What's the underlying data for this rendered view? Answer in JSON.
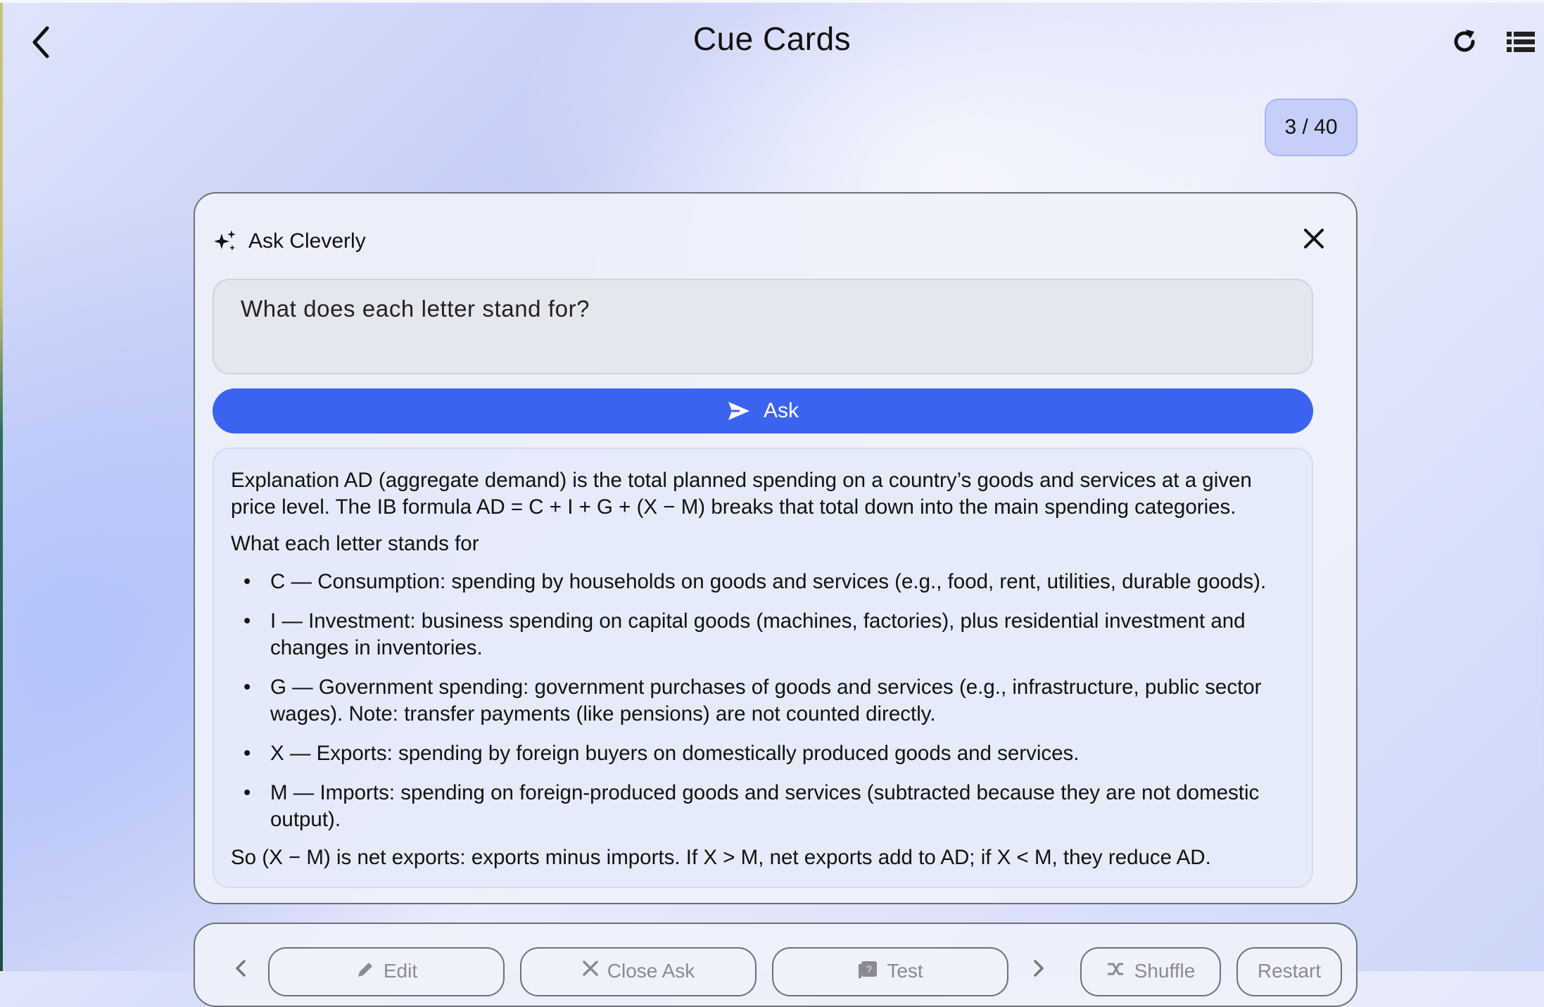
{
  "header": {
    "title": "Cue Cards"
  },
  "counter": {
    "text": "3 / 40"
  },
  "ask_panel": {
    "title": "Ask Cleverly",
    "question": "What does each letter stand for?",
    "ask_label": "Ask",
    "answer": {
      "intro": "Explanation AD (aggregate demand) is the total planned spending on a country’s goods and services at a given price level. The IB formula AD = C + I + G + (X − M) breaks that total down into the main spending categories.",
      "subheading": "What each letter stands for",
      "items": [
        "C — Consumption: spending by households on goods and services (e.g., food, rent, utilities, durable goods).",
        "I — Investment: business spending on capital goods (machines, factories), plus residential investment and changes in inventories.",
        "G — Government spending: government purchases of goods and services (e.g., infrastructure, public sector wages). Note: transfer payments (like pensions) are not counted directly.",
        "X — Exports: spending by foreign buyers on domestically produced goods and services.",
        "M — Imports: spending on foreign-produced goods and services (subtracted because they are not domestic output)."
      ],
      "conclusion": "So (X − M) is net exports: exports minus imports. If X > M, net exports add to AD; if X < M, they reduce AD."
    }
  },
  "toolbar": {
    "edit_label": "Edit",
    "close_ask_label": "Close Ask",
    "test_label": "Test",
    "shuffle_label": "Shuffle",
    "restart_label": "Restart"
  },
  "icons": {
    "back": "chevron-left-icon",
    "refresh": "refresh-icon",
    "list": "list-icon",
    "sparkle": "sparkle-icon",
    "close": "close-icon",
    "send": "send-icon"
  },
  "colors": {
    "accent": "#3c63f0",
    "counter_bg": "#c4cffa"
  }
}
